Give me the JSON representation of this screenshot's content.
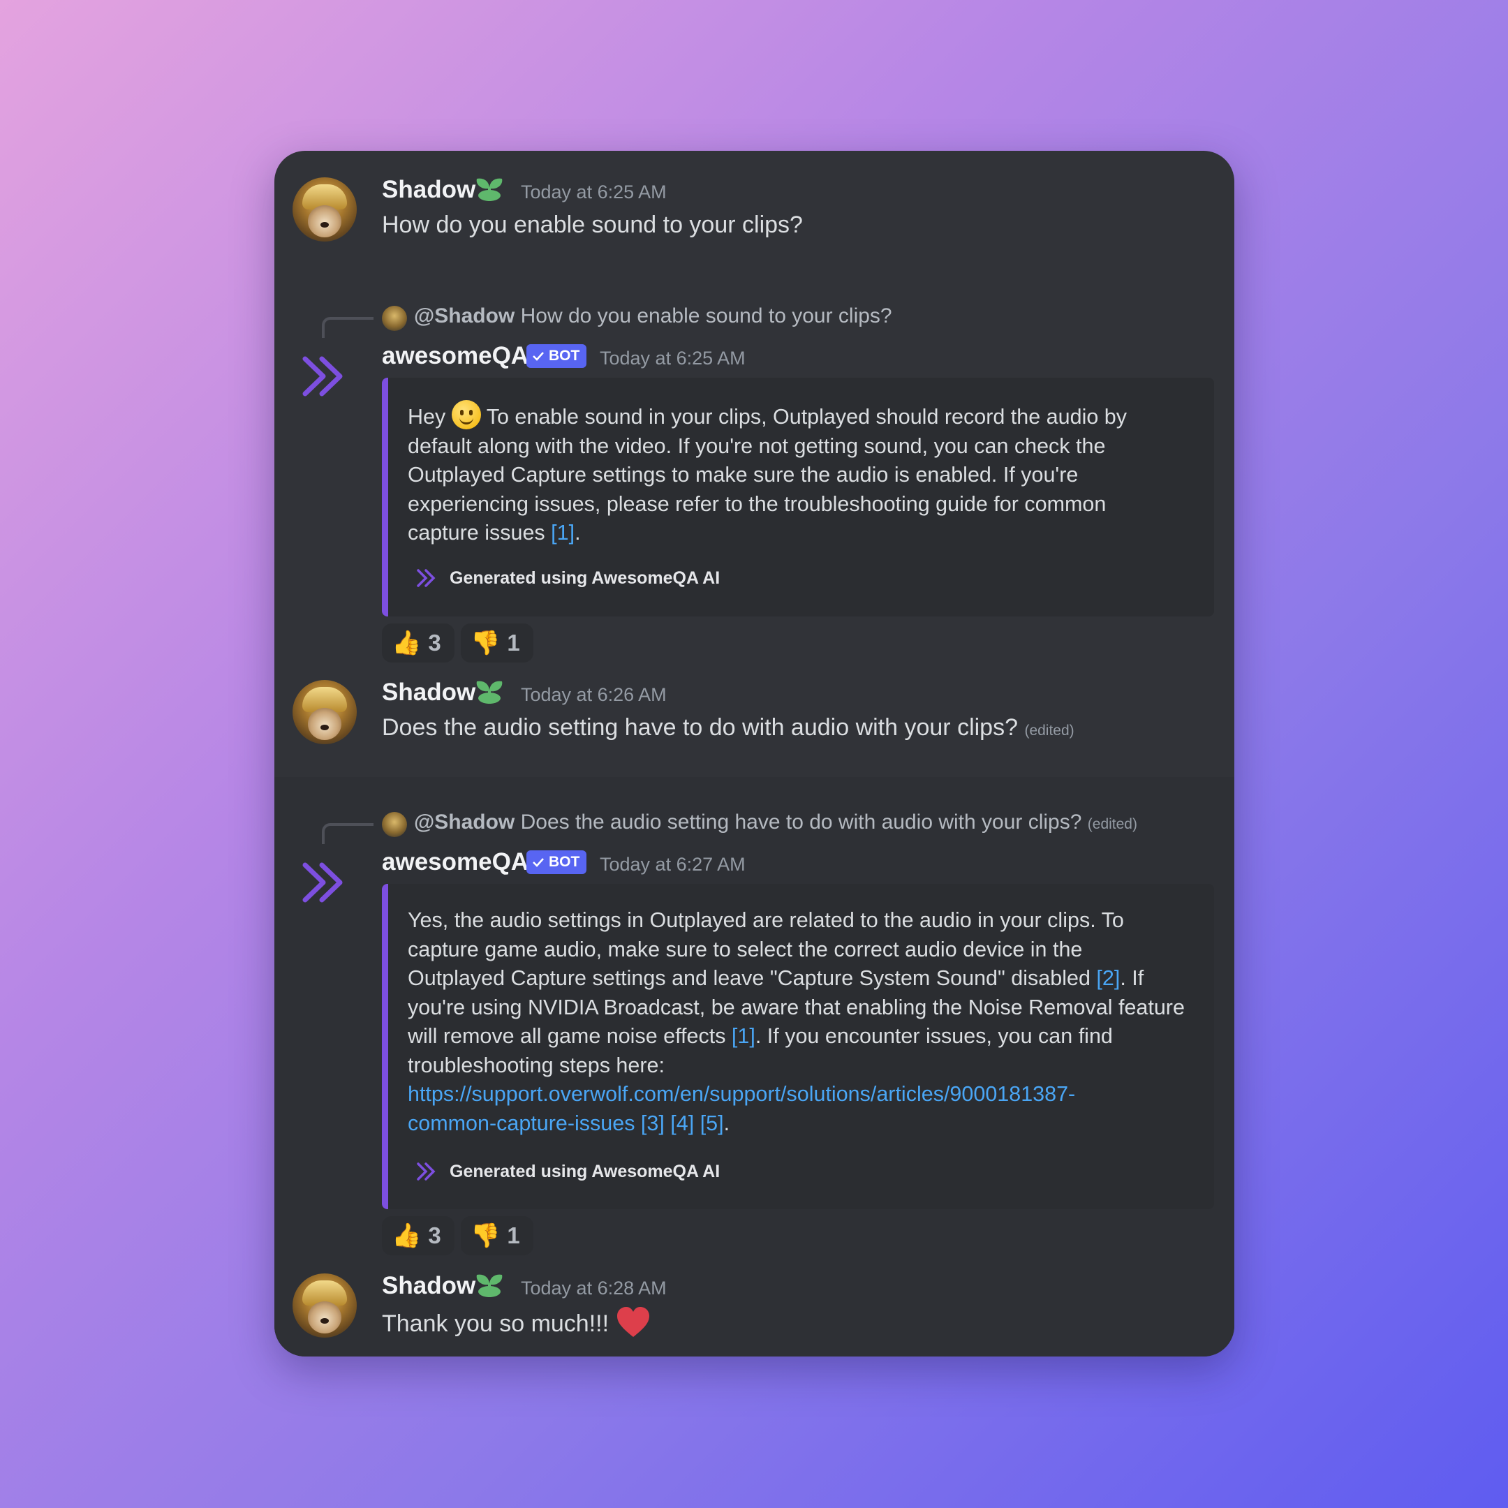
{
  "messages": [
    {
      "author": "Shadow",
      "time": "Today at 6:25 AM",
      "text": "How do you enable sound to your clips?"
    },
    {
      "reply_mention": "@Shadow",
      "reply_text": "How do you enable sound to your clips?",
      "author": "awesomeQA",
      "tag": "BOT",
      "time": "Today at 6:25 AM",
      "embed": {
        "lines": [
          [
            "Hey ",
            "To enable sound in your clips, Outplayed should record the audio by"
          ],
          "default along with the video. If you're not getting sound, you can check the",
          "Outplayed Capture settings to make sure the audio is enabled. If you're",
          "experiencing issues, please refer to the troubleshooting guide for common",
          [
            "capture issues ",
            "[1]",
            "."
          ]
        ],
        "footer": "Generated using AwesomeQA AI"
      },
      "reactions": [
        {
          "emoji": "👍",
          "count": "3"
        },
        {
          "emoji": "👎",
          "count": "1"
        }
      ]
    },
    {
      "author": "Shadow",
      "time": "Today at 6:26 AM",
      "text": "Does the audio setting have to do with audio with your clips?",
      "edited": "(edited)"
    },
    {
      "reply_mention": "@Shadow",
      "reply_text": "Does the audio setting have to do with audio with your clips?",
      "reply_edited": "(edited)",
      "author": "awesomeQA",
      "tag": "BOT",
      "time": "Today at 6:27 AM",
      "embed": {
        "lines": [
          "Yes, the audio settings in Outplayed are related to the audio in your clips. To",
          "capture game audio, make sure to select the correct audio device in the",
          [
            "Outplayed Capture settings and leave \"Capture System Sound\" disabled ",
            "[2]",
            ". If"
          ],
          "you're using NVIDIA Broadcast, be aware that enabling the Noise Removal feature",
          [
            "will remove all game noise effects ",
            "[1]",
            ". If you encounter issues, you can find"
          ],
          "troubleshooting steps here:",
          "https://support.overwolf.com/en/support/solutions/articles/9000181387-",
          [
            "common-capture-issues",
            " [3] [4] [5]",
            "."
          ]
        ],
        "footer": "Generated using AwesomeQA AI"
      },
      "reactions": [
        {
          "emoji": "👍",
          "count": "3"
        },
        {
          "emoji": "👎",
          "count": "1"
        }
      ]
    },
    {
      "author": "Shadow",
      "time": "Today at 6:28 AM",
      "text": "Thank you so much!!!",
      "emoji": "❤️"
    }
  ],
  "icons": {
    "user_badge": "sprout-badge-icon",
    "bot_avatar": "awesomeqa-chevrons-icon",
    "verified": "checkmark-icon"
  },
  "colors": {
    "background_panel": "#313338",
    "accent": "#7d4fe0",
    "bot_tag": "#5865f2",
    "link": "#4aa6f5",
    "badge_green": "#5fb86c",
    "heart": "#dd3f4b"
  }
}
